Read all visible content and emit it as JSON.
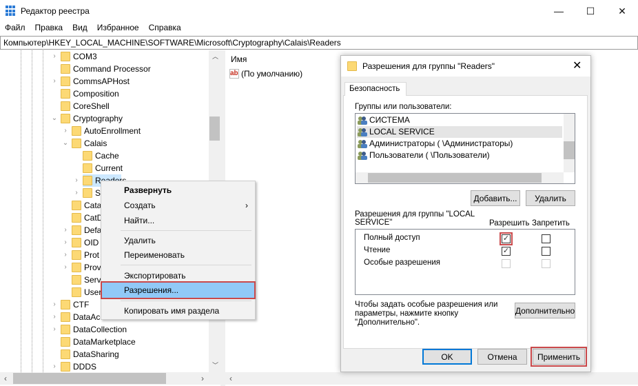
{
  "window": {
    "title": "Редактор реестра",
    "controls": [
      "—",
      "☐",
      "✕"
    ]
  },
  "menu": [
    "Файл",
    "Правка",
    "Вид",
    "Избранное",
    "Справка"
  ],
  "address": "Компьютер\\HKEY_LOCAL_MACHINE\\SOFTWARE\\Microsoft\\Cryptography\\Calais\\Readers",
  "tree": [
    {
      "label": "COM3",
      "level": 1,
      "expander": "collapsed"
    },
    {
      "label": "Command Processor",
      "level": 1,
      "expander": "none"
    },
    {
      "label": "CommsAPHost",
      "level": 1,
      "expander": "collapsed"
    },
    {
      "label": "Composition",
      "level": 1,
      "expander": "none"
    },
    {
      "label": "CoreShell",
      "level": 1,
      "expander": "none"
    },
    {
      "label": "Cryptography",
      "level": 1,
      "expander": "expanded"
    },
    {
      "label": "AutoEnrollment",
      "level": 2,
      "expander": "collapsed"
    },
    {
      "label": "Calais",
      "level": 2,
      "expander": "expanded"
    },
    {
      "label": "Cache",
      "level": 3,
      "expander": "none"
    },
    {
      "label": "Current",
      "level": 3,
      "expander": "none"
    },
    {
      "label": "Readers",
      "level": 3,
      "expander": "collapsed",
      "selected": true
    },
    {
      "label": "S",
      "level": 3,
      "expander": "collapsed"
    },
    {
      "label": "Cata",
      "level": 2,
      "expander": "none"
    },
    {
      "label": "CatD",
      "level": 2,
      "expander": "none"
    },
    {
      "label": "Defa",
      "level": 2,
      "expander": "collapsed"
    },
    {
      "label": "OID",
      "level": 2,
      "expander": "collapsed"
    },
    {
      "label": "Prot",
      "level": 2,
      "expander": "collapsed"
    },
    {
      "label": "Prov",
      "level": 2,
      "expander": "collapsed"
    },
    {
      "label": "Serv",
      "level": 2,
      "expander": "none"
    },
    {
      "label": "User",
      "level": 2,
      "expander": "none"
    },
    {
      "label": "CTF",
      "level": 1,
      "expander": "collapsed"
    },
    {
      "label": "DataAccess",
      "level": 1,
      "expander": "collapsed"
    },
    {
      "label": "DataCollection",
      "level": 1,
      "expander": "collapsed"
    },
    {
      "label": "DataMarketplace",
      "level": 1,
      "expander": "none"
    },
    {
      "label": "DataSharing",
      "level": 1,
      "expander": "none"
    },
    {
      "label": "DDDS",
      "level": 1,
      "expander": "collapsed"
    }
  ],
  "values_pane": {
    "column": "Имя",
    "items": [
      {
        "icon": "ab-string-icon",
        "name": "(По умолчанию)"
      }
    ]
  },
  "context_menu": {
    "expand": "Развернуть",
    "create": "Создать",
    "find": "Найти...",
    "delete": "Удалить",
    "rename": "Переименовать",
    "export": "Экспортировать",
    "permissions": "Разрешения...",
    "copy_name": "Копировать имя раздела"
  },
  "dialog": {
    "title": "Разрешения для группы \"Readers\"",
    "tab": "Безопасность",
    "groups_label": "Группы или пользователи:",
    "groups": [
      {
        "name": "СИСТЕМА"
      },
      {
        "name": "LOCAL SERVICE",
        "selected": true
      },
      {
        "name": "Администраторы (              \\Администраторы)"
      },
      {
        "name": "Пользователи (              \\Пользователи)"
      }
    ],
    "add": "Добавить...",
    "remove": "Удалить",
    "perm_label": "Разрешения для группы \"LOCAL SERVICE\"",
    "allow": "Разрешить",
    "deny": "Запретить",
    "permissions": [
      {
        "name": "Полный доступ",
        "allow": true,
        "deny": false,
        "disabled": false
      },
      {
        "name": "Чтение",
        "allow": true,
        "deny": false,
        "disabled": false
      },
      {
        "name": "Особые разрешения",
        "allow": false,
        "deny": false,
        "disabled": true
      }
    ],
    "advanced_hint": "Чтобы задать особые разрешения или параметры, нажмите кнопку \"Дополнительно\".",
    "advanced": "Дополнительно",
    "ok": "OK",
    "cancel": "Отмена",
    "apply": "Применить"
  },
  "colors": {
    "highlight_box": "#c9484a",
    "selection": "#cce8ff",
    "menu_highlight": "#91c9f7",
    "folder": "#fcd975"
  }
}
